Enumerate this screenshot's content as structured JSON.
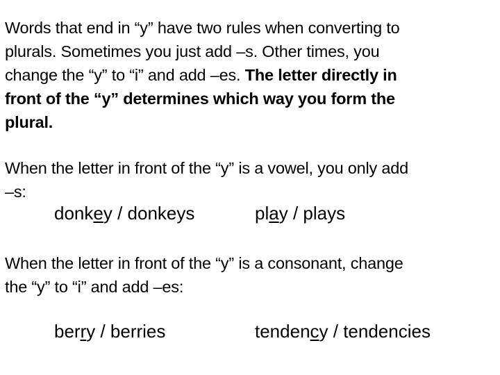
{
  "intro": {
    "lines": [
      "Words that end in “y” have two rules when converting to",
      "plurals. Sometimes you just add –s. Other times, you",
      "change the “y” to “i” and add –es. "
    ],
    "bold_line3_tail": "The letter directly in",
    "bold_lines": [
      "front of the “y” determines which way you form the",
      "plural."
    ]
  },
  "vowel_rule": {
    "lines": [
      "When the letter in front of the “y” is a vowel, you only add",
      "–s:"
    ],
    "examples": [
      {
        "pre": "donk",
        "underlined": "e",
        "post": "y / donkeys"
      },
      {
        "pre": "pl",
        "underlined": "a",
        "post": "y / plays"
      }
    ]
  },
  "consonant_rule": {
    "lines": [
      "When the letter in front of the “y” is a consonant, change",
      "the “y” to “i” and add –es:"
    ],
    "examples": [
      {
        "pre": "ber",
        "underlined": "r",
        "post": "y / berries"
      },
      {
        "pre": "tenden",
        "underlined": "c",
        "post": "y / tendencies"
      }
    ]
  }
}
